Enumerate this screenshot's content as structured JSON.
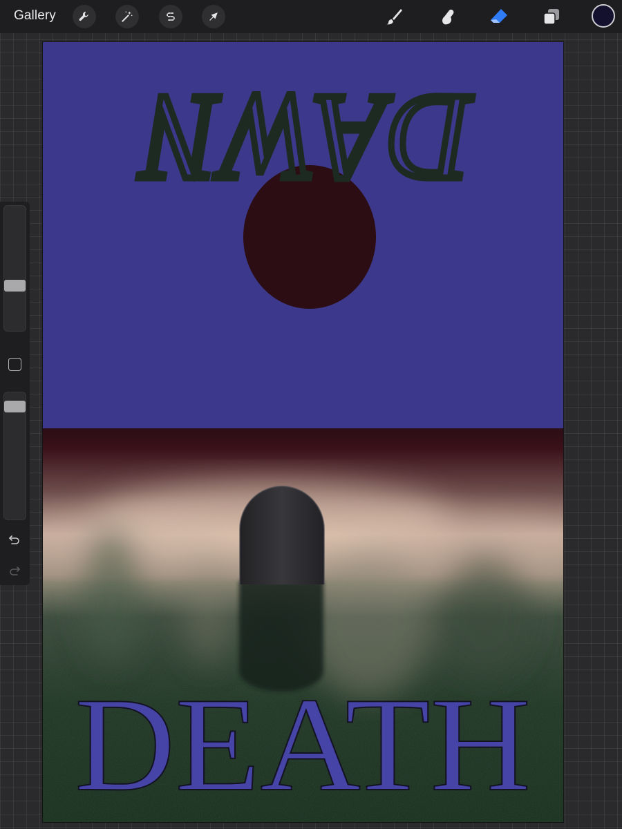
{
  "toolbar": {
    "gallery_label": "Gallery",
    "left_tools": [
      {
        "name": "actions",
        "icon": "wrench-icon"
      },
      {
        "name": "adjustments",
        "icon": "magic-wand-icon"
      },
      {
        "name": "selection",
        "icon": "selection-s-icon"
      },
      {
        "name": "transform",
        "icon": "arrow-cursor-icon"
      }
    ],
    "right_tools": [
      {
        "name": "brush",
        "icon": "brush-icon",
        "active": false
      },
      {
        "name": "smudge",
        "icon": "smudge-icon",
        "active": false
      },
      {
        "name": "eraser",
        "icon": "eraser-icon",
        "active": true
      },
      {
        "name": "layers",
        "icon": "layers-icon",
        "active": false
      }
    ],
    "current_color": "#13112e",
    "active_color": "#2f7cf6"
  },
  "sidebar": {
    "brush_size_level": 0.35,
    "opacity_level": 0.93,
    "icons": [
      "modify-square-icon",
      "undo-icon",
      "redo-icon"
    ]
  },
  "artwork": {
    "top_text": "DAWN",
    "bottom_text": "DEATH",
    "colors": {
      "sky": "#3c388b",
      "moon": "#2b0d13",
      "horizon": "#3a0f18",
      "mist": "#d9bca8",
      "ground": "#1e3323",
      "tombstone": "#2d2c30",
      "dawn_text": "#1d2a22",
      "death_text": "#4744a8"
    }
  }
}
